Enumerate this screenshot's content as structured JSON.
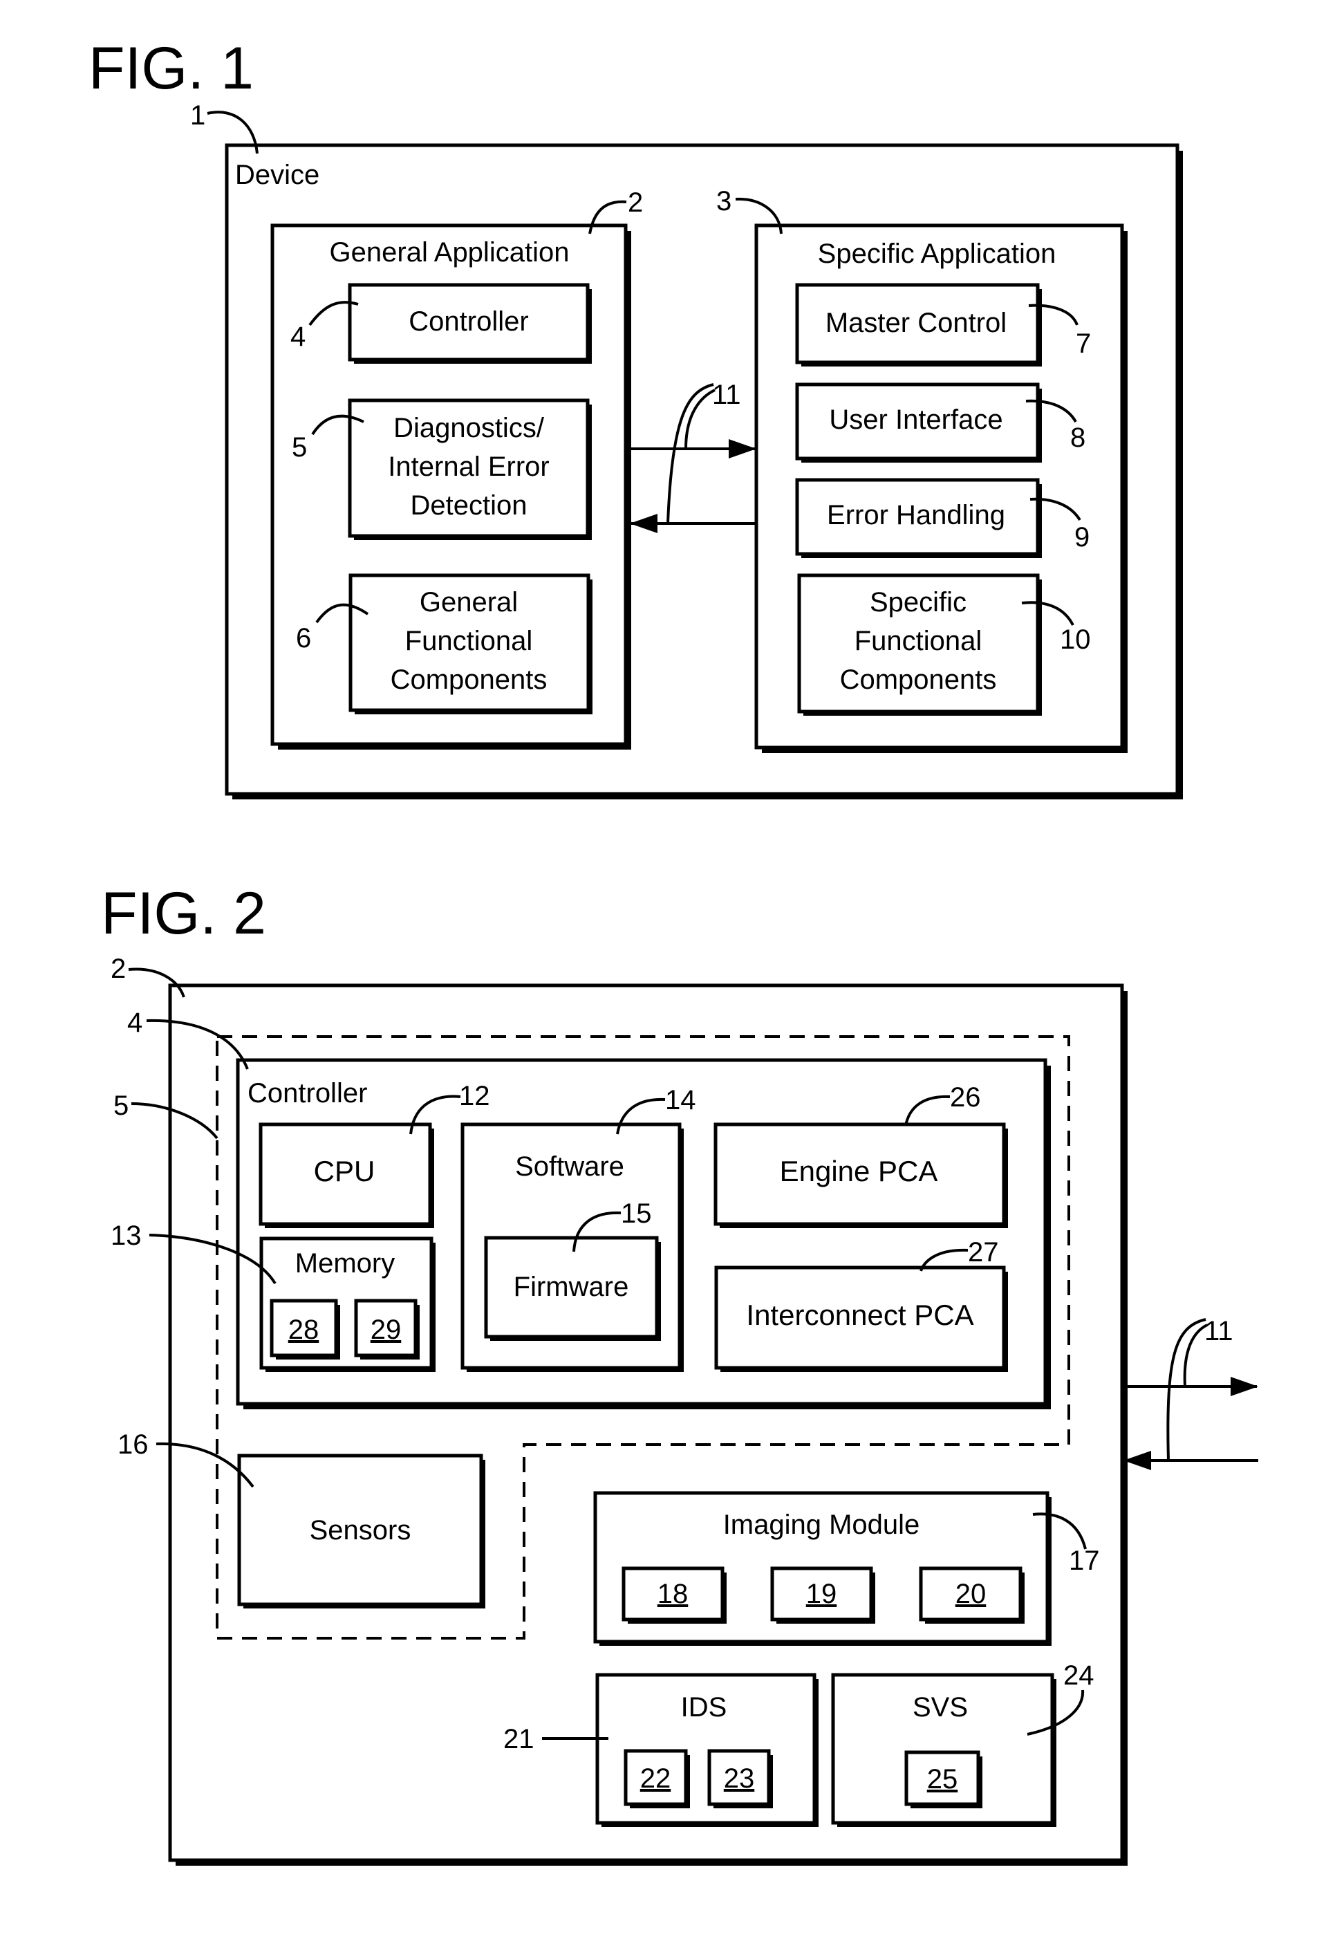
{
  "fig1": {
    "title": "FIG. 1",
    "device": {
      "label": "Device",
      "ref": "1"
    },
    "general_application": {
      "label": "General Application",
      "ref": "2"
    },
    "specific_application": {
      "label": "Specific Application",
      "ref": "3"
    },
    "controller": {
      "label": "Controller",
      "ref": "4"
    },
    "diagnostics": {
      "lines": [
        "Diagnostics/",
        "Internal Error",
        "Detection"
      ],
      "ref": "5"
    },
    "general_functional": {
      "lines": [
        "General",
        "Functional",
        "Components"
      ],
      "ref": "6"
    },
    "master_control": {
      "label": "Master Control",
      "ref": "7"
    },
    "user_interface": {
      "label": "User Interface",
      "ref": "8"
    },
    "error_handling": {
      "label": "Error Handling",
      "ref": "9"
    },
    "specific_functional": {
      "lines": [
        "Specific",
        "Functional",
        "Components"
      ],
      "ref": "10"
    },
    "interface_ref": "11"
  },
  "fig2": {
    "title": "FIG. 2",
    "general_application_ref": "2",
    "controller": {
      "label": "Controller",
      "ref": "4"
    },
    "diagnostics_ref": "5",
    "cpu": {
      "label": "CPU",
      "ref": "12"
    },
    "memory": {
      "label": "Memory",
      "ref": "13",
      "items": [
        "28",
        "29"
      ]
    },
    "software": {
      "label": "Software",
      "ref": "14"
    },
    "firmware": {
      "label": "Firmware",
      "ref": "15"
    },
    "engine_pca": {
      "label": "Engine PCA",
      "ref": "26"
    },
    "interconnect_pca": {
      "label": "Interconnect PCA",
      "ref": "27"
    },
    "sensors": {
      "label": "Sensors",
      "ref": "16"
    },
    "imaging_module": {
      "label": "Imaging Module",
      "ref": "17",
      "items": [
        "18",
        "19",
        "20"
      ]
    },
    "ids": {
      "label": "IDS",
      "ref": "21",
      "items": [
        "22",
        "23"
      ]
    },
    "svs": {
      "label": "SVS",
      "ref": "24",
      "items": [
        "25"
      ]
    },
    "interface_ref": "11"
  }
}
